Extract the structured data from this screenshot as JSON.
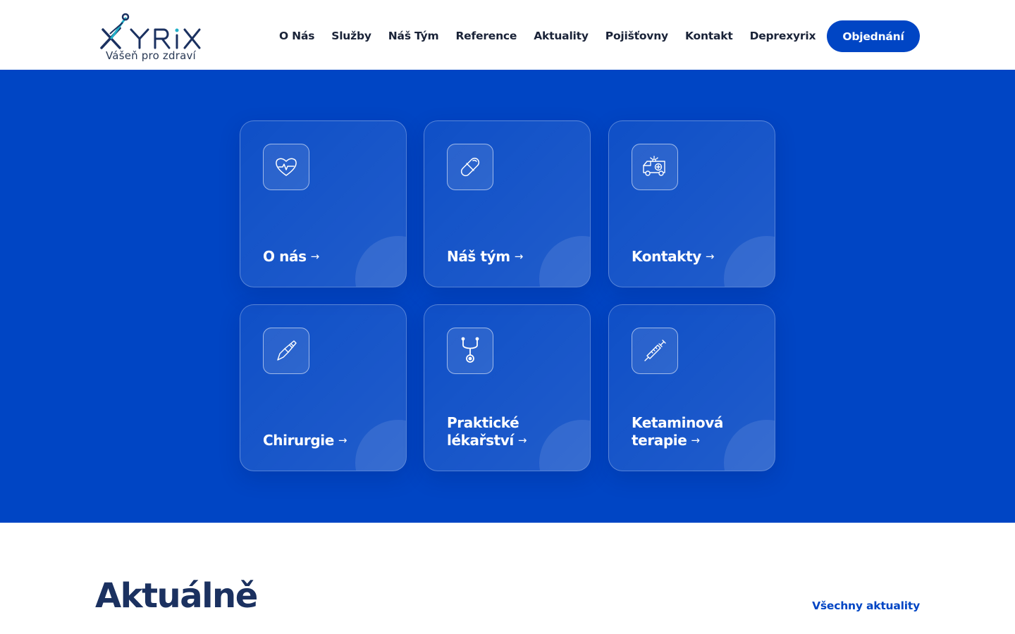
{
  "header": {
    "logo_text": "XYRiX",
    "tagline": "Vášeň pro zdraví",
    "nav": [
      {
        "label": "O Nás"
      },
      {
        "label": "Služby"
      },
      {
        "label": "Náš Tým"
      },
      {
        "label": "Reference"
      },
      {
        "label": "Aktuality"
      },
      {
        "label": "Pojišťovny"
      },
      {
        "label": "Kontakt"
      },
      {
        "label": "Deprexyrix"
      }
    ],
    "cta_label": "Objednání"
  },
  "hero": {
    "background_color": "#0045c4",
    "cards": [
      {
        "label": "O nás",
        "icon": "heart-pulse-icon"
      },
      {
        "label": "Náš tým",
        "icon": "pill-icon"
      },
      {
        "label": "Kontakty",
        "icon": "ambulance-icon"
      },
      {
        "label": "Chirurgie",
        "icon": "scalpel-icon"
      },
      {
        "label": "Praktické lékařství",
        "icon": "stethoscope-icon"
      },
      {
        "label": "Ketaminová terapie",
        "icon": "syringe-icon"
      }
    ],
    "arrow_glyph": "→"
  },
  "news": {
    "title": "Aktuálně",
    "all_link": "Všechny aktuality"
  },
  "colors": {
    "accent": "#0045c4",
    "heading": "#1b3160",
    "logo_teal": "#22b0c8"
  }
}
